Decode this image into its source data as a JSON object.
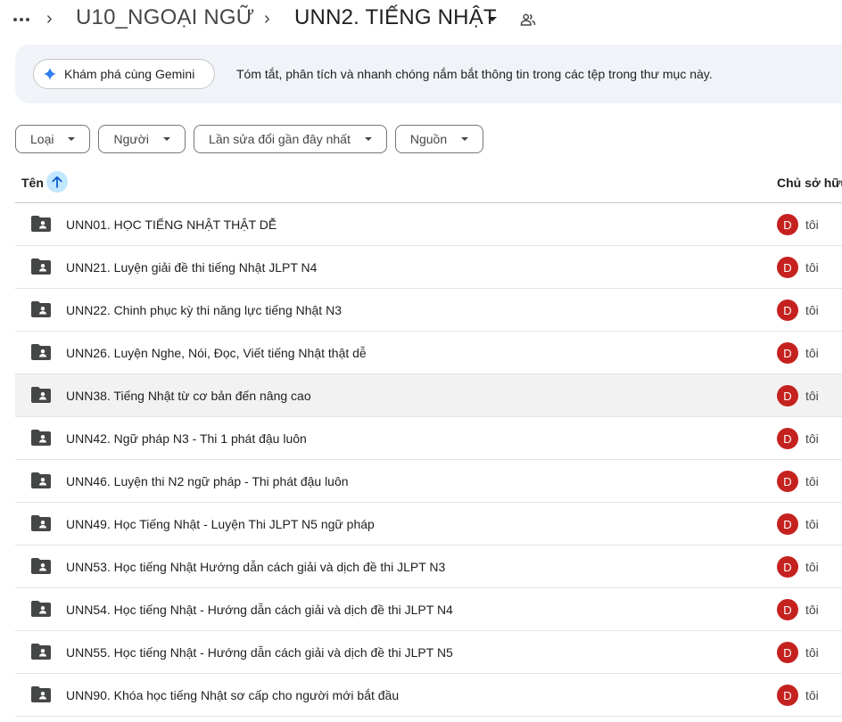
{
  "breadcrumb": {
    "parent": "U10_NGOẠI NGỮ",
    "current": "UNN2. TIẾNG NHẬT"
  },
  "gemini": {
    "button_label": "Khám phá cùng Gemini",
    "description": "Tóm tắt, phân tích và nhanh chóng nắm bắt thông tin trong các tệp trong thư mục này."
  },
  "filters": [
    "Loại",
    "Người",
    "Lần sửa đổi gần đây nhất",
    "Nguồn"
  ],
  "header": {
    "name": "Tên",
    "owner": "Chủ sở hữu"
  },
  "rows": [
    {
      "name": "UNN01. HỌC TIẾNG NHẬT THẬT DỄ",
      "avatar": "D",
      "owner": "tôi"
    },
    {
      "name": "UNN21. Luyện giải đề thi tiếng Nhật JLPT N4",
      "avatar": "D",
      "owner": "tôi"
    },
    {
      "name": "UNN22. Chinh phục kỳ thi năng lực tiếng Nhật N3",
      "avatar": "D",
      "owner": "tôi"
    },
    {
      "name": "UNN26. Luyện Nghe, Nói, Đọc, Viết tiếng Nhật thật dễ",
      "avatar": "D",
      "owner": "tôi"
    },
    {
      "name": "UNN38. Tiếng Nhật từ cơ bản đến nâng cao",
      "avatar": "D",
      "owner": "tôi"
    },
    {
      "name": "UNN42. Ngữ pháp N3 - Thi 1 phát đậu luôn",
      "avatar": "D",
      "owner": "tôi"
    },
    {
      "name": "UNN46. Luyện thi N2 ngữ pháp - Thi phát đậu luôn",
      "avatar": "D",
      "owner": "tôi"
    },
    {
      "name": "UNN49. Học Tiếng Nhật - Luyện Thi JLPT N5 ngữ pháp",
      "avatar": "D",
      "owner": "tôi"
    },
    {
      "name": "UNN53. Học tiếng Nhật Hướng dẫn cách giải và dịch đề thi JLPT N3",
      "avatar": "D",
      "owner": "tôi"
    },
    {
      "name": "UNN54. Học tiếng Nhật - Hướng dẫn cách giải và dịch đề thi JLPT N4",
      "avatar": "D",
      "owner": "tôi"
    },
    {
      "name": "UNN55. Học tiếng Nhật - Hướng dẫn cách giải và dịch đề thi JLPT N5",
      "avatar": "D",
      "owner": "tôi"
    },
    {
      "name": "UNN90. Khóa học tiếng Nhật sơ cấp cho người mới bắt đầu",
      "avatar": "D",
      "owner": "tôi"
    }
  ],
  "highlighted_row": 4,
  "colors": {
    "avatar": "#c5221f",
    "sort_button": "#c2e7ff",
    "banner": "#f0f4f9"
  }
}
